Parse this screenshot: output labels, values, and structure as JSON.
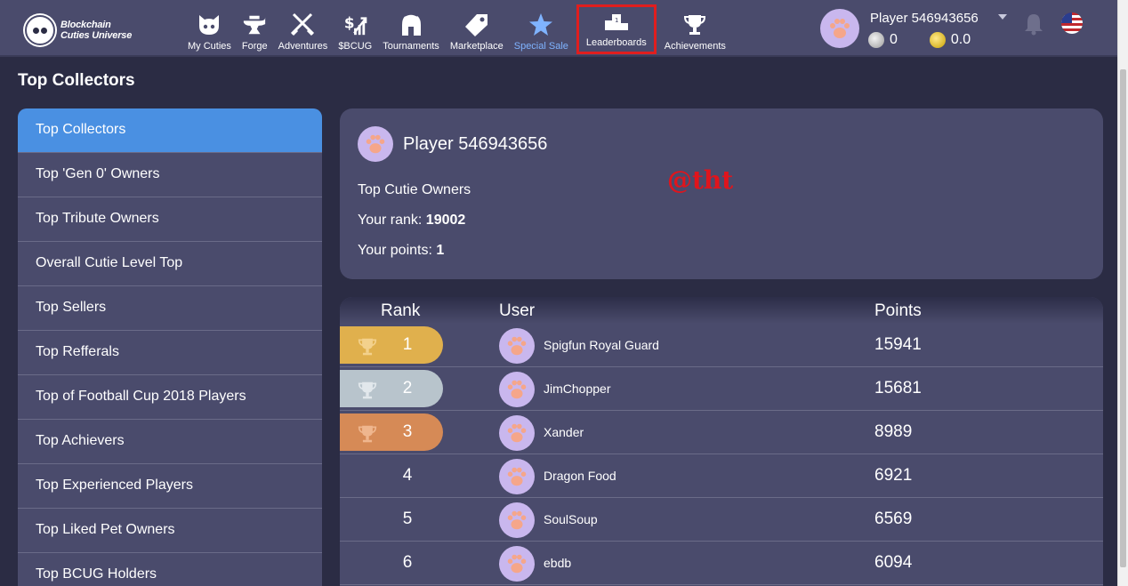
{
  "brand": {
    "line1": "Blockchain",
    "line2": "Cuties Universe"
  },
  "nav": [
    {
      "label": "My Cuties",
      "icon": "cat-face-icon"
    },
    {
      "label": "Forge",
      "icon": "anvil-icon"
    },
    {
      "label": "Adventures",
      "icon": "crossed-swords-icon"
    },
    {
      "label": "$BCUG",
      "icon": "dollar-chart-icon"
    },
    {
      "label": "Tournaments",
      "icon": "spartan-helmet-icon"
    },
    {
      "label": "Marketplace",
      "icon": "price-tag-icon"
    },
    {
      "label": "Special Sale",
      "icon": "star-icon"
    },
    {
      "label": "Leaderboards",
      "icon": "podium-icon"
    },
    {
      "label": "Achievements",
      "icon": "trophy-icon"
    }
  ],
  "header": {
    "player_name": "Player 546943656",
    "silver_balance": "0",
    "gold_balance": "0.0"
  },
  "page": {
    "title": "Top Collectors"
  },
  "sidebar": [
    "Top Collectors",
    "Top 'Gen 0' Owners",
    "Top Tribute Owners",
    "Overall Cutie Level Top",
    "Top Sellers",
    "Top Refferals",
    "Top of Football Cup 2018 Players",
    "Top Achievers",
    "Top Experienced Players",
    "Top Liked Pet Owners",
    "Top BCUG Holders"
  ],
  "card": {
    "player_name": "Player 546943656",
    "category": "Top Cutie Owners",
    "rank_label": "Your rank: ",
    "rank_value": "19002",
    "points_label": "Your points: ",
    "points_value": "1",
    "watermark": "@tht"
  },
  "table": {
    "headers": {
      "rank": "Rank",
      "user": "User",
      "points": "Points"
    },
    "rows": [
      {
        "rank": "1",
        "user": "Spigfun Royal Guard",
        "points": "15941"
      },
      {
        "rank": "2",
        "user": "JimChopper",
        "points": "15681"
      },
      {
        "rank": "3",
        "user": "Xander",
        "points": "8989"
      },
      {
        "rank": "4",
        "user": "Dragon Food",
        "points": "6921"
      },
      {
        "rank": "5",
        "user": "SoulSoup",
        "points": "6569"
      },
      {
        "rank": "6",
        "user": "ebdb",
        "points": "6094"
      }
    ]
  },
  "colors": {
    "header_bg": "#4a4b6c",
    "page_bg": "#2b2c44",
    "accent": "#4a90e2",
    "active_nav": "#7fb3ff",
    "highlight_box": "#e01e1e",
    "gold": "#e0b04d",
    "silver": "#b8c4cc",
    "bronze": "#d68a56"
  }
}
